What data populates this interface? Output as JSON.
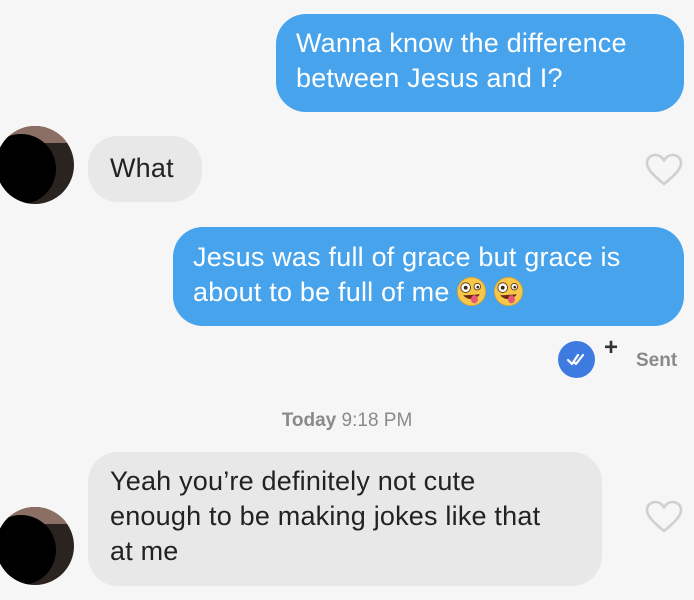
{
  "messages": [
    {
      "direction": "outgoing",
      "lines": [
        "Wanna know the difference",
        "between Jesus and I?"
      ]
    },
    {
      "direction": "incoming",
      "lines": [
        "What"
      ],
      "reaction_icon": "heart-outline-icon"
    },
    {
      "direction": "outgoing",
      "lines": [
        "Jesus was full of grace but grace is",
        "about to be full of me"
      ],
      "emojis": [
        "zany-face-emoji",
        "zany-face-emoji"
      ]
    },
    {
      "direction": "incoming",
      "lines": [
        "Yeah you’re definitely not cute",
        "enough to be making jokes like that",
        "at me"
      ],
      "reaction_icon": "heart-outline-icon"
    }
  ],
  "status": {
    "badge_icon": "double-check-icon",
    "plus": "+",
    "label": "Sent"
  },
  "timestamp": {
    "day": "Today",
    "time": "9:18 PM"
  },
  "colors": {
    "outgoing_bubble": "#47a3ec",
    "incoming_bubble": "#e8e8e8",
    "background": "#f6f6f6",
    "read_badge": "#3e7be0"
  }
}
